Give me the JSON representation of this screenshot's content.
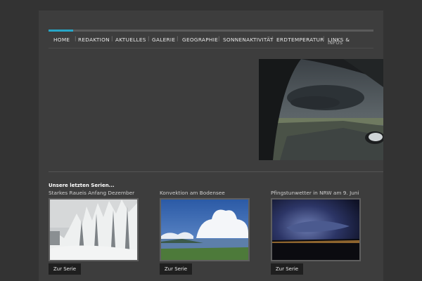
{
  "nav": {
    "items": [
      "HOME",
      "REDAKTION",
      "AKTUELLES",
      "GALERIE",
      "GEOGRAPHIE",
      "SONNENAKTIVITÄT",
      "ERDTEMPERATUR",
      "LINKS &",
      "INFOS"
    ],
    "separator": "|",
    "active_color": "#27a6c7"
  },
  "section": {
    "title": "Unsere letzten Serien..."
  },
  "series": [
    {
      "title": "Starkes Raueis Anfang Dezember",
      "button": "Zur Serie"
    },
    {
      "title": "Konvektion am Bodensee",
      "button": "Zur Serie"
    },
    {
      "title": "Pfingstunwetter in NRW am 9. Juni",
      "button": "Zur Serie"
    }
  ]
}
